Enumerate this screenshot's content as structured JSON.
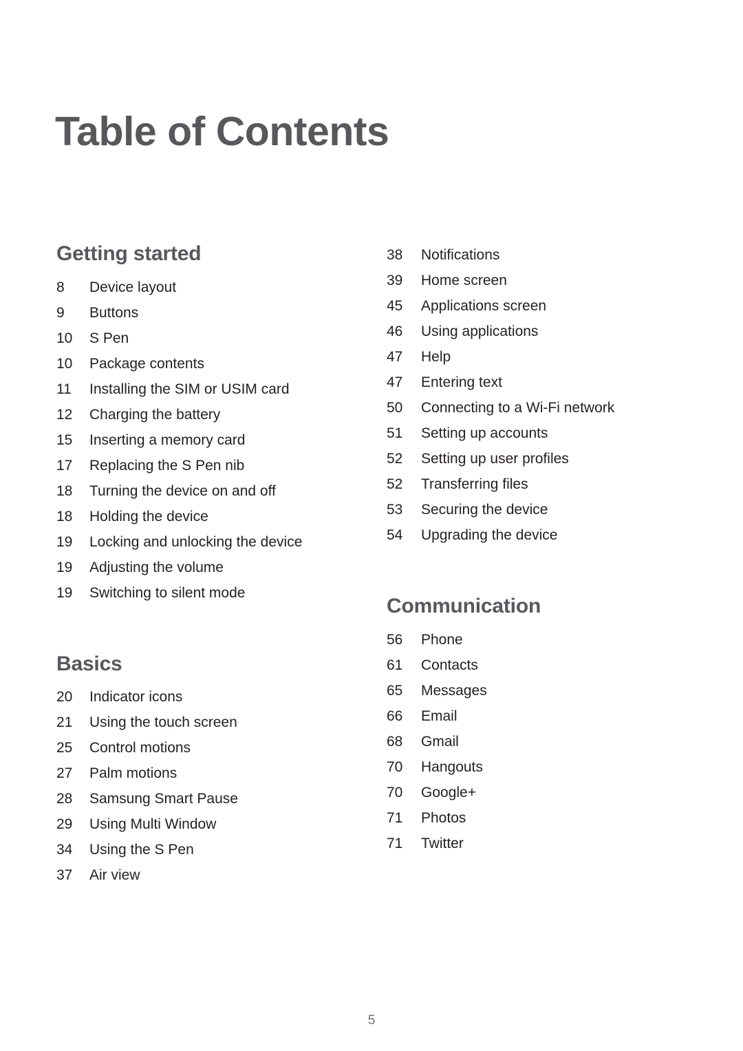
{
  "document": {
    "title": "Table of Contents",
    "folio": "5",
    "colors": {
      "heading": "#58585c",
      "body": "#231f20",
      "folio": "#6b7175",
      "background": "#ffffff"
    }
  },
  "columns": [
    {
      "name": "left-column",
      "sections": [
        {
          "heading": "Getting started",
          "entries": [
            {
              "page": "8",
              "label": "Device layout"
            },
            {
              "page": "9",
              "label": "Buttons"
            },
            {
              "page": "10",
              "label": "S Pen"
            },
            {
              "page": "10",
              "label": "Package contents"
            },
            {
              "page": "11",
              "label": "Installing the SIM or USIM card"
            },
            {
              "page": "12",
              "label": "Charging the battery"
            },
            {
              "page": "15",
              "label": "Inserting a memory card"
            },
            {
              "page": "17",
              "label": "Replacing the S Pen nib"
            },
            {
              "page": "18",
              "label": "Turning the device on and off"
            },
            {
              "page": "18",
              "label": "Holding the device"
            },
            {
              "page": "19",
              "label": "Locking and unlocking the device"
            },
            {
              "page": "19",
              "label": "Adjusting the volume"
            },
            {
              "page": "19",
              "label": "Switching to silent mode"
            }
          ]
        },
        {
          "heading": "Basics",
          "entries": [
            {
              "page": "20",
              "label": "Indicator icons"
            },
            {
              "page": "21",
              "label": "Using the touch screen"
            },
            {
              "page": "25",
              "label": "Control motions"
            },
            {
              "page": "27",
              "label": "Palm motions"
            },
            {
              "page": "28",
              "label": "Samsung Smart Pause"
            },
            {
              "page": "29",
              "label": "Using Multi Window"
            },
            {
              "page": "34",
              "label": "Using the S Pen"
            },
            {
              "page": "37",
              "label": "Air view"
            }
          ]
        }
      ]
    },
    {
      "name": "right-column",
      "sections": [
        {
          "heading": "",
          "entries": [
            {
              "page": "38",
              "label": "Notifications"
            },
            {
              "page": "39",
              "label": "Home screen"
            },
            {
              "page": "45",
              "label": "Applications screen"
            },
            {
              "page": "46",
              "label": "Using applications"
            },
            {
              "page": "47",
              "label": "Help"
            },
            {
              "page": "47",
              "label": "Entering text"
            },
            {
              "page": "50",
              "label": "Connecting to a Wi-Fi network"
            },
            {
              "page": "51",
              "label": "Setting up accounts"
            },
            {
              "page": "52",
              "label": "Setting up user profiles"
            },
            {
              "page": "52",
              "label": "Transferring files"
            },
            {
              "page": "53",
              "label": "Securing the device"
            },
            {
              "page": "54",
              "label": "Upgrading the device"
            }
          ]
        },
        {
          "heading": "Communication",
          "entries": [
            {
              "page": "56",
              "label": "Phone"
            },
            {
              "page": "61",
              "label": "Contacts"
            },
            {
              "page": "65",
              "label": "Messages"
            },
            {
              "page": "66",
              "label": "Email"
            },
            {
              "page": "68",
              "label": "Gmail"
            },
            {
              "page": "70",
              "label": "Hangouts"
            },
            {
              "page": "70",
              "label": "Google+"
            },
            {
              "page": "71",
              "label": "Photos"
            },
            {
              "page": "71",
              "label": "Twitter"
            }
          ]
        }
      ]
    }
  ]
}
